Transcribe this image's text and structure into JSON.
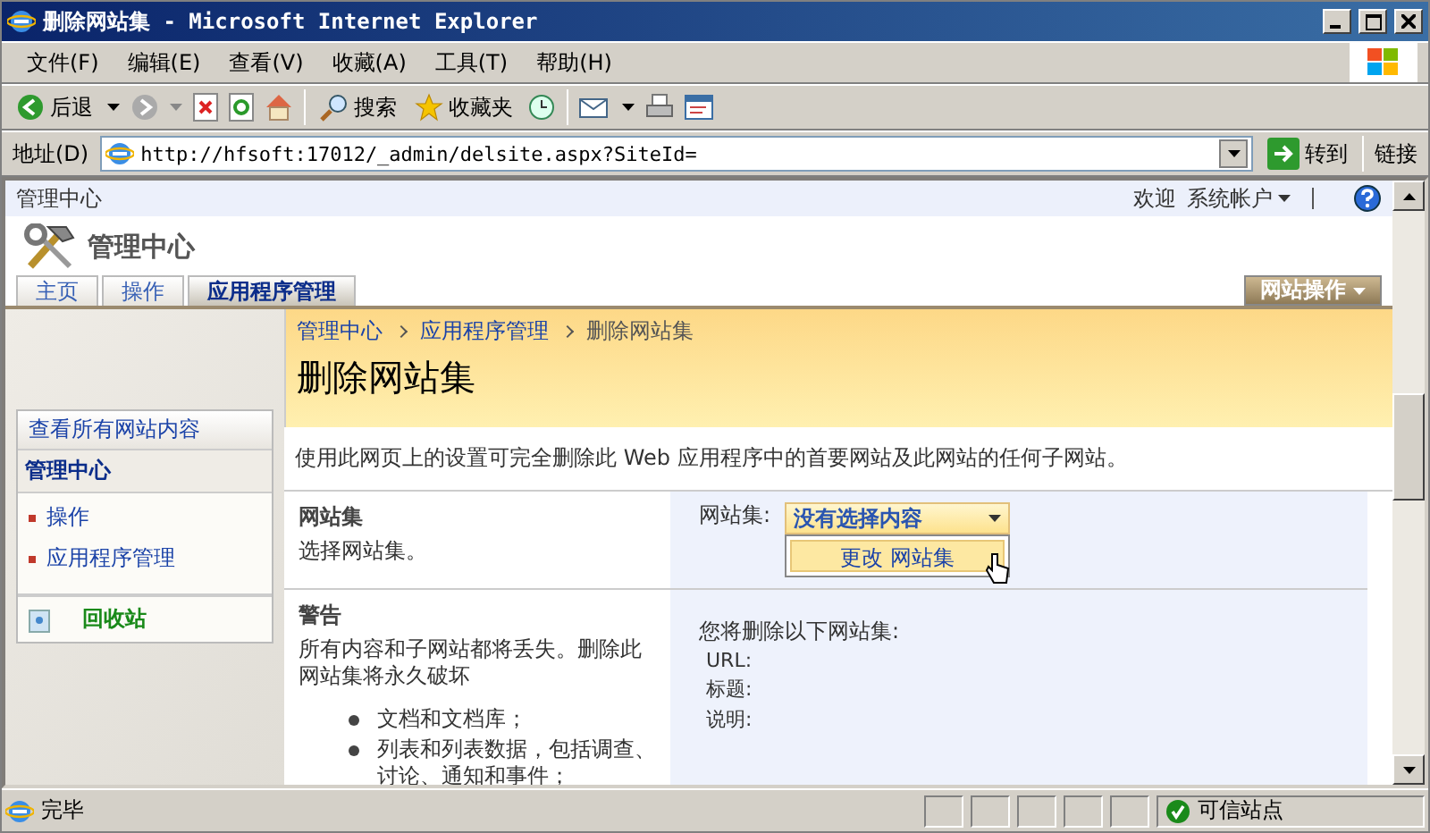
{
  "window": {
    "title": "删除网站集 - Microsoft Internet Explorer"
  },
  "menu": [
    "文件(F)",
    "编辑(E)",
    "查看(V)",
    "收藏(A)",
    "工具(T)",
    "帮助(H)"
  ],
  "toolbar": {
    "back": "后退",
    "search": "搜索",
    "favorites": "收藏夹"
  },
  "address": {
    "label": "地址(D)",
    "url": "http://hfsoft:17012/_admin/delsite.aspx?SiteId=",
    "go": "转到",
    "links": "链接"
  },
  "top_bar": {
    "site": "管理中心",
    "welcome": "欢迎",
    "user": "系统帐户"
  },
  "site_title": "管理中心",
  "tabs": [
    {
      "label": "主页",
      "selected": false
    },
    {
      "label": "操作",
      "selected": false
    },
    {
      "label": "应用程序管理",
      "selected": true
    }
  ],
  "site_actions": "网站操作",
  "breadcrumb": [
    "管理中心",
    "应用程序管理",
    "删除网站集"
  ],
  "page_title": "删除网站集",
  "sidebar": {
    "view_all": "查看所有网站内容",
    "heading": "管理中心",
    "items": [
      "操作",
      "应用程序管理"
    ],
    "recycle_bin": "回收站"
  },
  "description": "使用此网页上的设置可完全删除此 Web 应用程序中的首要网站及此网站的任何子网站。",
  "site_collection": {
    "title": "网站集",
    "help": "选择网站集。",
    "field_label": "网站集:",
    "value": "没有选择内容",
    "menu_item": "更改 网站集"
  },
  "warning": {
    "title": "警告",
    "text": "所有内容和子网站都将丢失。删除此网站集将永久破坏",
    "bullets": [
      "文档和文档库；",
      "列表和列表数据，包括调查、讨论、通知和事件；"
    ],
    "heading": "您将删除以下网站集:",
    "fields": [
      "URL:",
      "标题:",
      "说明:"
    ]
  },
  "status": {
    "text": "完毕",
    "zone": "可信站点"
  }
}
